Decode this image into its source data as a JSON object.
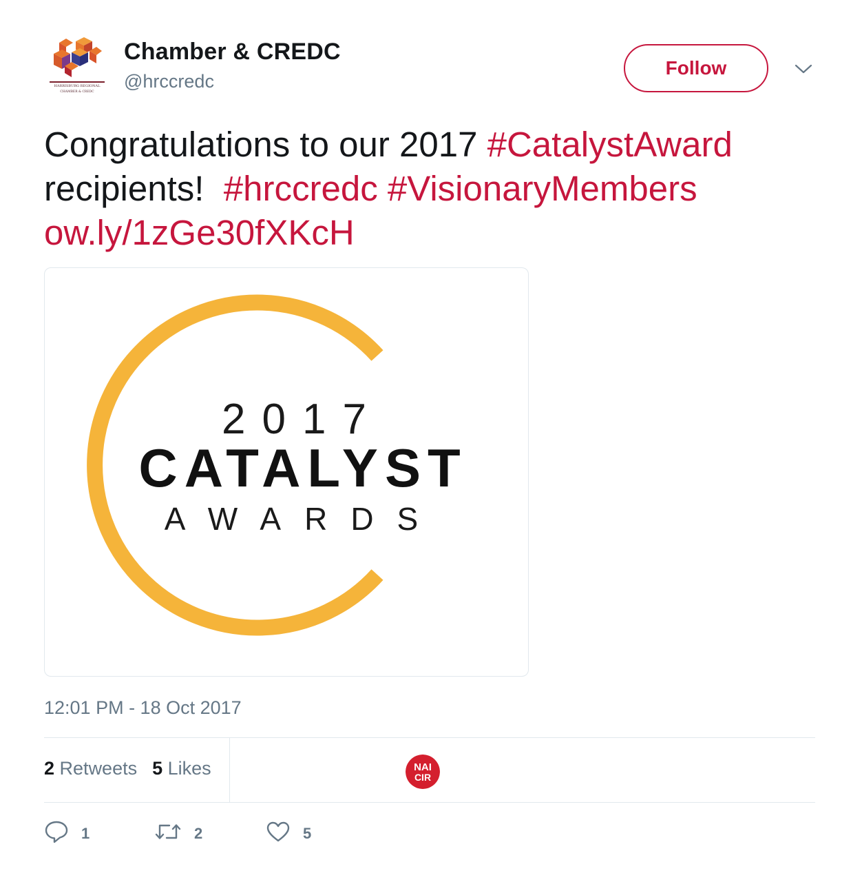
{
  "header": {
    "display_name": "Chamber & CREDC",
    "handle": "@hrccredc",
    "follow_label": "Follow",
    "avatar_icon": "harrisburg-regional-chamber-logo"
  },
  "tweet": {
    "line1_text": "Congratulations to our 2017 ",
    "line1_tag": "#CatalystAward",
    "line2_text": "recipients!  ",
    "line2_tag1": "#hrccredc",
    "line2_tag2": "#VisionaryMembers",
    "line3_link": "ow.ly/1zGe30fXKcH"
  },
  "media": {
    "year": "2017",
    "title": "CATALYST",
    "subtitle": "AWARDS",
    "ring_color": "#f5b43a"
  },
  "timestamp": "12:01 PM - 18 Oct 2017",
  "stats": {
    "retweets_count": "2",
    "retweets_label": "Retweets",
    "likes_count": "5",
    "likes_label": "Likes",
    "liker_avatar_text": "NAI CIR"
  },
  "actions": {
    "reply_count": "1",
    "retweet_count": "2",
    "like_count": "5"
  },
  "colors": {
    "accent": "#c6163d",
    "muted": "#657786",
    "text": "#14171a"
  }
}
